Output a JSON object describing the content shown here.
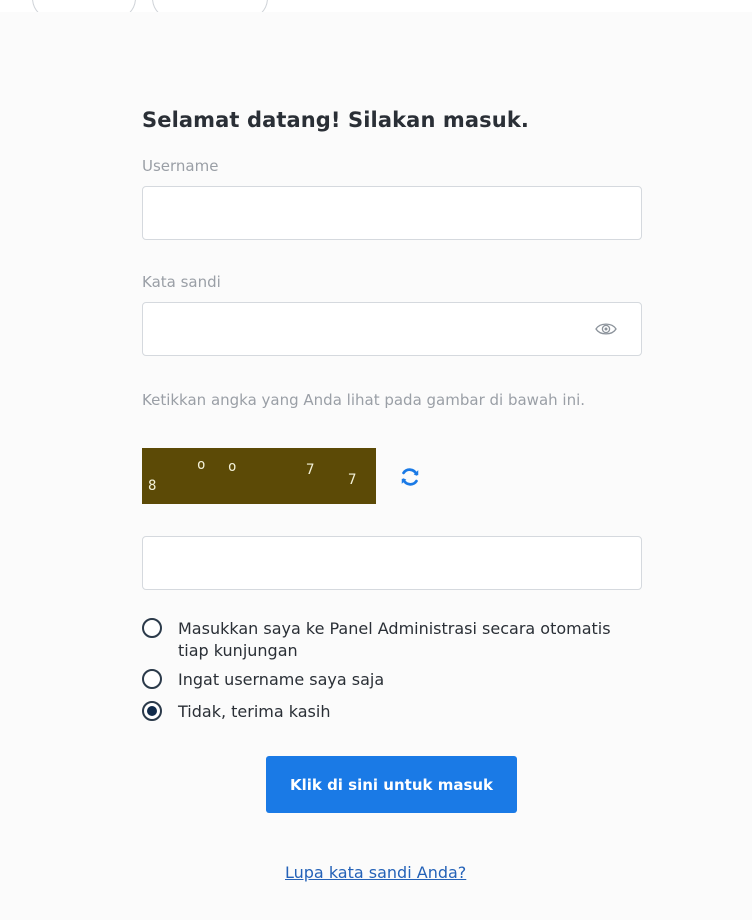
{
  "page": {
    "background": "#fbfbfb"
  },
  "login": {
    "heading": "Selamat datang! Silakan masuk.",
    "username_label": "Username",
    "username_value": "",
    "password_label": "Kata sandi",
    "password_value": "",
    "password_toggle_icon": "eye-icon",
    "captcha_label": "Ketikkan angka yang Anda lihat pada gambar di bawah ini.",
    "captcha_chars": [
      "8",
      "o",
      "o",
      "7",
      "7"
    ],
    "captcha_background": "#5c4a06",
    "captcha_refresh_icon": "refresh-icon",
    "captcha_value": ""
  },
  "options": [
    {
      "label": "Masukkan saya ke Panel Administrasi secara otomatis tiap kunjungan",
      "checked": false
    },
    {
      "label": "Ingat username saya saja",
      "checked": false
    },
    {
      "label": "Tidak, terima kasih",
      "checked": true
    }
  ],
  "submit_label": "Klik di sini untuk masuk",
  "forgot_link": "Lupa kata sandi Anda?",
  "colors": {
    "primary_button": "#1a7ae6",
    "link": "#2462b8",
    "refresh_icon": "#1a7ae6"
  }
}
